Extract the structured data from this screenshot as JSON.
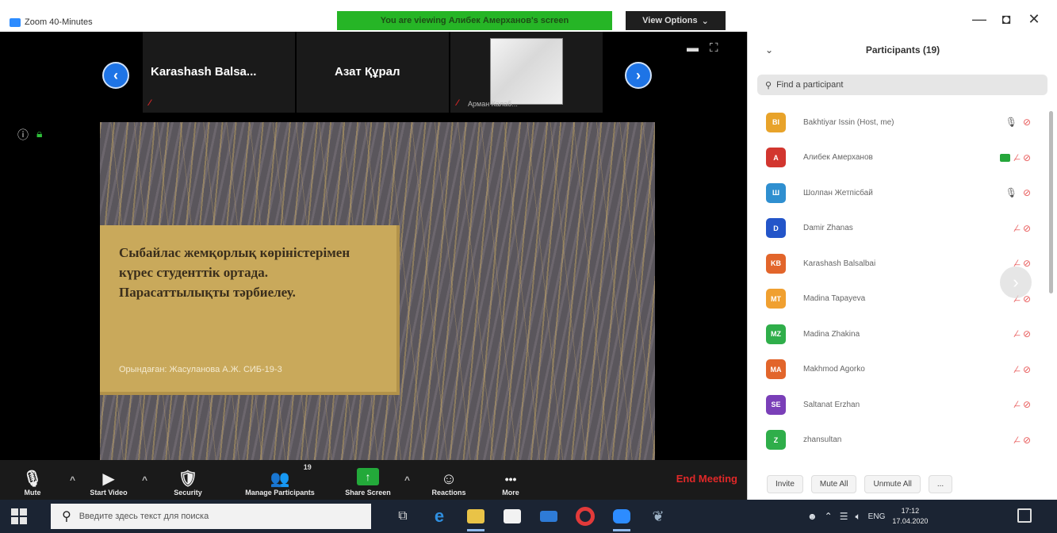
{
  "window": {
    "app_title": "Zoom 40-Minutes",
    "share_banner": "You are viewing Алибек Амерханов's screen",
    "view_options": "View Options",
    "minimize": "—",
    "maximize": "◘",
    "close": "✕"
  },
  "video_strip": {
    "participants": [
      {
        "name": "Karashash  Balsa...",
        "muted": "⁄̶"
      },
      {
        "name": "Азат Құрал",
        "muted": ""
      },
      {
        "name": "",
        "label": "Арман Калаб...",
        "muted": "⁄̶"
      }
    ],
    "prev_icon": "‹",
    "next_icon": "›"
  },
  "slide": {
    "title": "Сыбайлас жемқорлық көріністерімен күрес студенттік ортада. Парасаттылықты тәрбиелеу.",
    "author": "Орындаған: Жасуланова А.Ж.  СИБ-19-3"
  },
  "toolbar": {
    "items": [
      {
        "label": "Mute",
        "icon": "🎙"
      },
      {
        "label": "Start Video",
        "icon": "▶"
      },
      {
        "label": "Security",
        "icon": "🛡"
      },
      {
        "label": "Manage Participants",
        "icon": "👥",
        "count": "19"
      },
      {
        "label": "Share Screen",
        "icon": "↑"
      },
      {
        "label": "Reactions",
        "icon": "☺"
      },
      {
        "label": "More",
        "icon": "•••"
      }
    ],
    "end_meeting": "End Meeting",
    "caret": "^"
  },
  "participants_panel": {
    "title": "Participants (19)",
    "collapse": "⌄",
    "search_placeholder": "Find a participant",
    "list": [
      {
        "initials": "BI",
        "name": "Bakhtiyar Issin (Host, me)",
        "color": "#e8a32a",
        "mic": "on"
      },
      {
        "initials": "A",
        "name": "Алибек Амерханов",
        "color": "#d2362f",
        "mic": "off",
        "video": "on"
      },
      {
        "initials": "Ш",
        "name": "Шолпан Жетпісбай",
        "color": "#2f8fd0",
        "mic": "on"
      },
      {
        "initials": "D",
        "name": "Damir Zhanas",
        "color": "#2355c9",
        "mic": "off"
      },
      {
        "initials": "KB",
        "name": "Karashash Balsalbai",
        "color": "#e2652b",
        "mic": "off"
      },
      {
        "initials": "MT",
        "name": "Madina Tapayeva",
        "color": "#f0a030",
        "mic": "off"
      },
      {
        "initials": "MZ",
        "name": "Madina Zhakina",
        "color": "#2fae4a",
        "mic": "off"
      },
      {
        "initials": "MA",
        "name": "Makhmod Agorko",
        "color": "#e2652b",
        "mic": "off"
      },
      {
        "initials": "SE",
        "name": "Saltanat Erzhan",
        "color": "#7a3fb8",
        "mic": "off"
      },
      {
        "initials": "Z",
        "name": "zhansultan",
        "color": "#2fae4a",
        "mic": "off"
      }
    ],
    "footer": {
      "invite": "Invite",
      "mute_all": "Mute All",
      "unmute_all": "Unmute All",
      "more": "..."
    }
  },
  "taskbar": {
    "search_placeholder": "Введите здесь текст для поиска",
    "lang": "ENG",
    "time": "17:12",
    "date": "17.04.2020"
  }
}
